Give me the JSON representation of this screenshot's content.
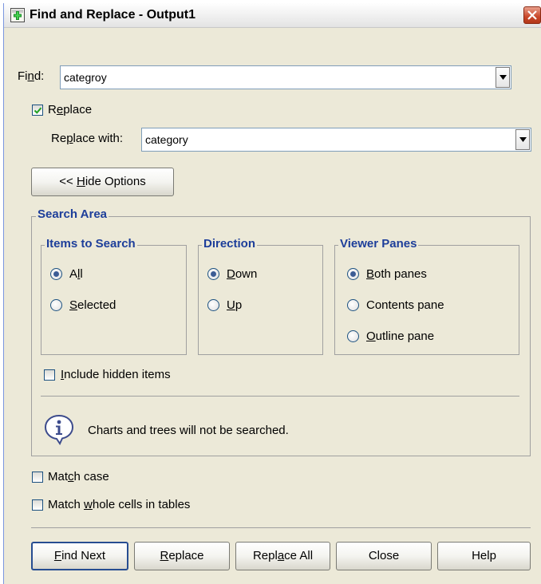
{
  "window": {
    "title": "Find and Replace - Output1"
  },
  "find": {
    "label": "Find:",
    "value": "categroy"
  },
  "replace": {
    "checkbox_label": "Replace",
    "checked": true,
    "with_label": "Replace with:",
    "value": "category"
  },
  "hide_options_label": "<< Hide Options",
  "search_area": {
    "title": "Search Area",
    "items_to_search": {
      "title": "Items to Search",
      "options": [
        "All",
        "Selected"
      ],
      "selected": "All"
    },
    "direction": {
      "title": "Direction",
      "options": [
        "Down",
        "Up"
      ],
      "selected": "Down"
    },
    "viewer_panes": {
      "title": "Viewer Panes",
      "options": [
        "Both panes",
        "Contents pane",
        "Outline pane"
      ],
      "selected": "Both panes"
    },
    "include_hidden_label": "Include hidden items",
    "info_text": "Charts and trees will not be searched."
  },
  "match_case_label": "Match case",
  "match_whole_label": "Match whole cells in tables",
  "buttons": {
    "find_next": "Find Next",
    "replace": "Replace",
    "replace_all": "Replace All",
    "close": "Close",
    "help": "Help"
  },
  "colors": {
    "legend": "#1d3e9a",
    "dialog_bg": "#ece9d8",
    "close_button": "#c9472a"
  }
}
